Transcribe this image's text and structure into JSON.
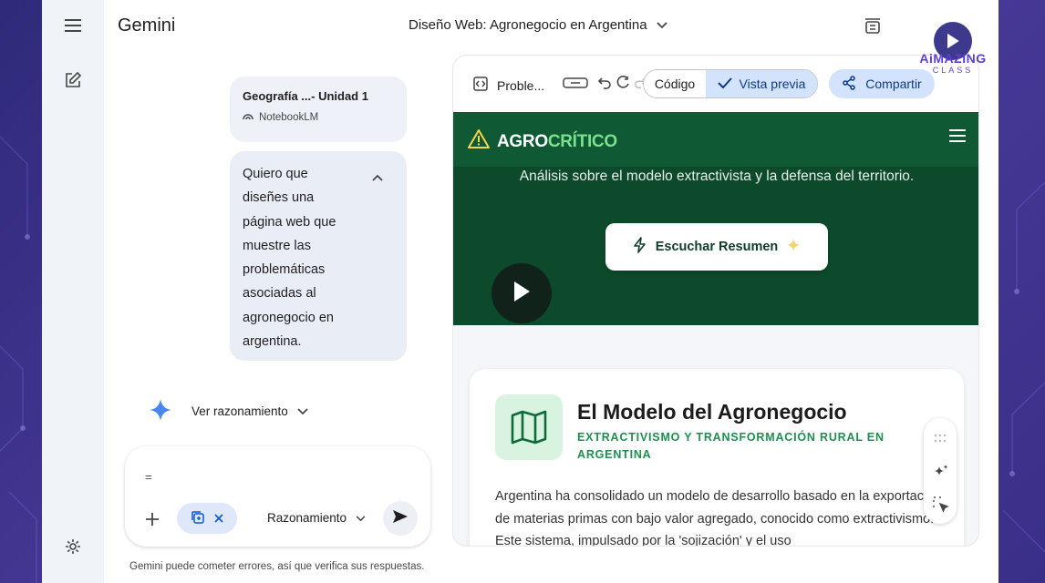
{
  "app": {
    "brand": "Gemini",
    "conversation_title": "Diseño Web: Agronegocio en Argentina"
  },
  "chat": {
    "source_card": {
      "title": "Geografía ...- Unidad 1",
      "source": "NotebookLM"
    },
    "prompt_text": "Quiero que diseñes una página web que muestre las problemáticas asociadas al agronegocio en argentina.",
    "reasoning_label": "Ver razonamiento"
  },
  "composer": {
    "input_value": "=",
    "mode_label": "Razonamiento"
  },
  "disclaimer": "Gemini puede cometer errores, así que verifica sus respuestas.",
  "canvas": {
    "doc_title": "Proble...",
    "code_tab": "Código",
    "preview_tab": "Vista previa",
    "share_label": "Compartir"
  },
  "site": {
    "logo_part1": "AGRO",
    "logo_part2": "CRÍTICO",
    "hero_subtitle": "Análisis sobre el modelo extractivista y la defensa del territorio.",
    "hero_button": "Escuchar Resumen",
    "section_title": "El Modelo del Agronegocio",
    "section_kicker": "EXTRACTIVISMO Y TRANSFORMACIÓN RURAL EN ARGENTINA",
    "section_body": "Argentina ha consolidado un modelo de desarrollo basado en la exportación de materias primas con bajo valor agregado, conocido como extractivismo. Este sistema, impulsado por la 'sojización' y el uso"
  },
  "watermark": {
    "name": "AiMAZING",
    "sub": "CLASS"
  },
  "colors": {
    "nav_green": "#0f5a35",
    "hero_green": "#0d4a2c",
    "accent_green": "#7be08a",
    "primary_blue": "#0b57d0",
    "backdrop_purple": "#3b2f86"
  },
  "icons": [
    "menu-icon",
    "new-chat-icon",
    "settings-icon",
    "chevron-down-icon",
    "archive-icon",
    "notebooklm-icon",
    "collapse-icon",
    "sparkle-icon",
    "plus-icon",
    "files-icon",
    "close-icon",
    "send-icon",
    "code-icon",
    "toggle-icon",
    "undo-icon",
    "redo-icon",
    "check-icon",
    "share-icon",
    "warning-icon",
    "hamburger-icon",
    "bolt-icon",
    "play-icon",
    "map-icon",
    "grid-icon",
    "magic-edit-icon",
    "select-icon"
  ]
}
